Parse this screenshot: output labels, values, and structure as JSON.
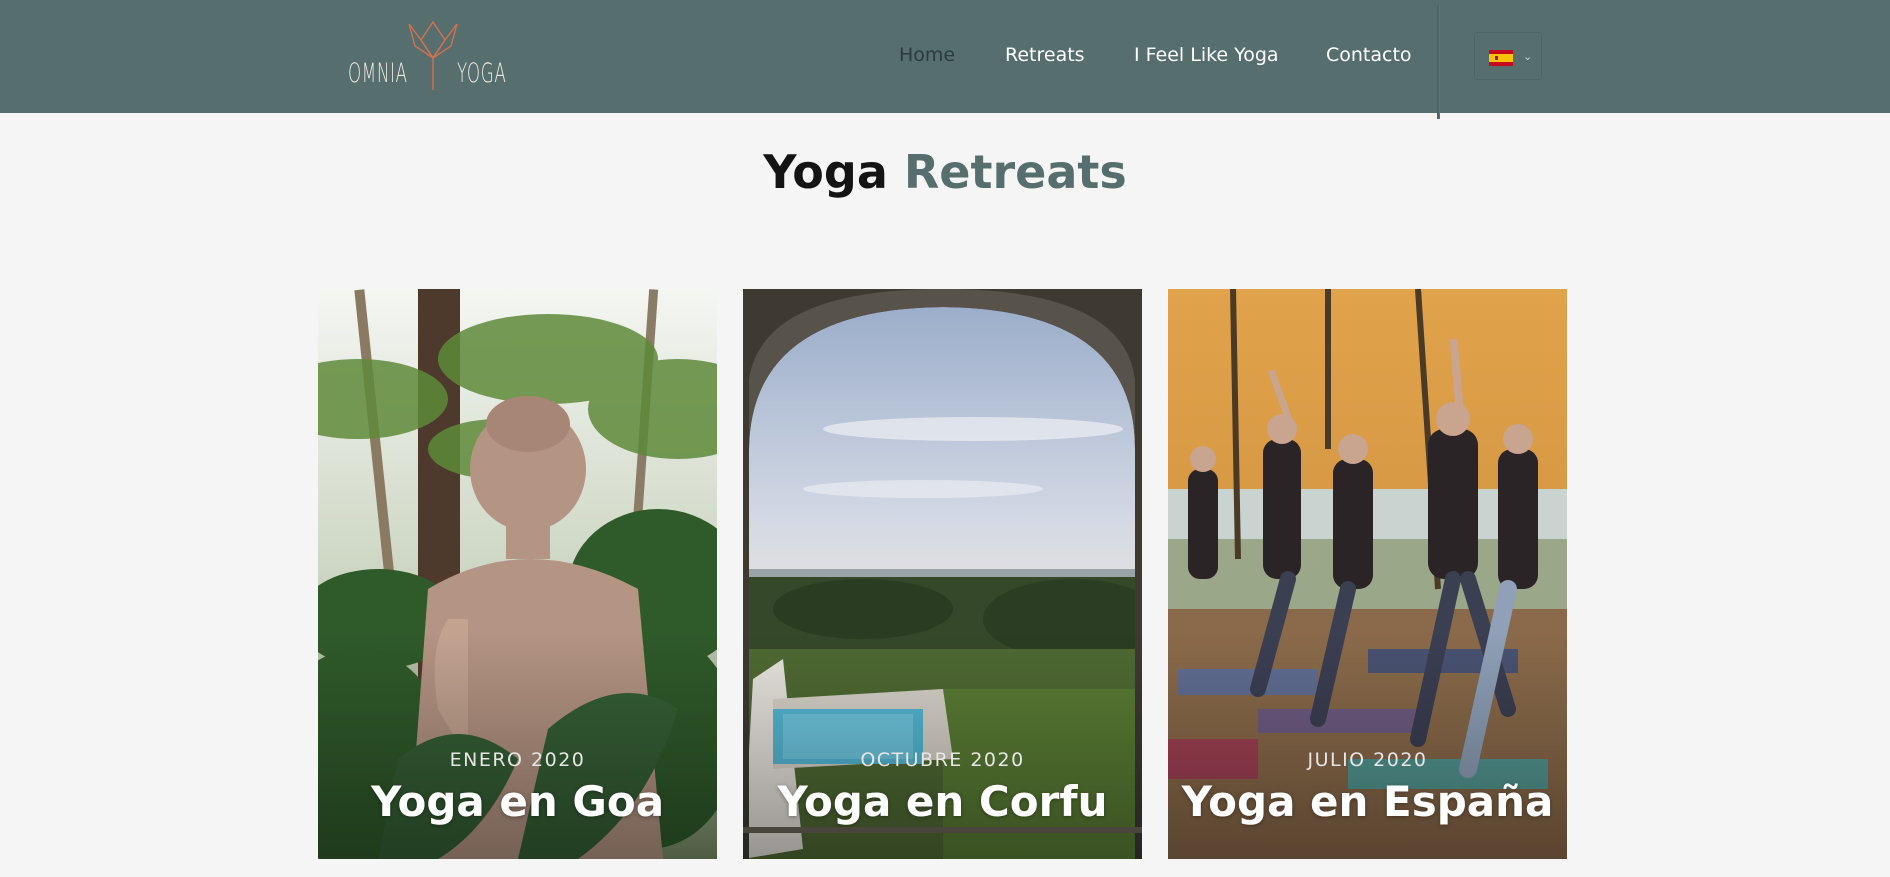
{
  "header": {
    "logo": {
      "word_left": "OMNIA",
      "word_right": "YOGA"
    },
    "nav": [
      {
        "label": "Home",
        "active": true
      },
      {
        "label": "Retreats",
        "active": false
      },
      {
        "label": "I Feel Like Yoga",
        "active": false
      },
      {
        "label": "Contacto",
        "active": false
      }
    ],
    "language": {
      "selected_flag": "spain-flag-icon",
      "dropdown_icon": "chevron-down-icon"
    }
  },
  "page": {
    "title_part1": "Yoga",
    "title_part2": "Retreats"
  },
  "retreats": [
    {
      "date": "ENERO 2020",
      "title": "Yoga en Goa",
      "image": "buddha-statue-palms-photo"
    },
    {
      "date": "OCTUBRE 2020",
      "title": "Yoga en Corfu",
      "image": "arch-pool-sea-view-photo"
    },
    {
      "date": "JULIO 2020",
      "title": "Yoga en España",
      "image": "group-yoga-tent-photo"
    }
  ],
  "colors": {
    "header_bg": "#566e6e",
    "accent": "#566e6e",
    "logo_orange": "#d4714e",
    "page_bg": "#f5f5f5"
  }
}
